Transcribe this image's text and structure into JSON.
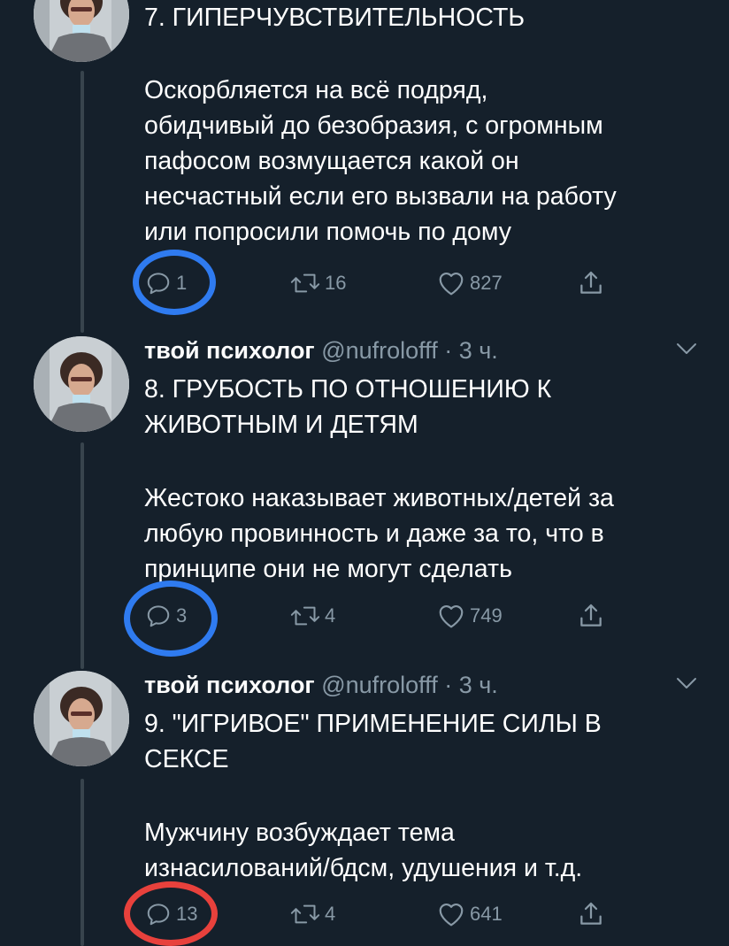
{
  "tweets": [
    {
      "author_name": "",
      "author_handle": "",
      "time": "",
      "heading": "7. ГИПЕРЧУВСТВИТЕЛЬНОСТЬ",
      "body": "Оскорбляется на всё подряд,\nобидчивый до безобразия, с огромным\nпафосом возмущается какой он\nнесчастный если его вызвали на работу\nили попросили помочь по дому",
      "replies": "1",
      "retweets": "16",
      "likes": "827"
    },
    {
      "author_name": "твой психолог",
      "author_handle": "@nufrolofff",
      "time": "· 3 ч.",
      "heading": "8. ГРУБОСТЬ ПО ОТНОШЕНИЮ К\nЖИВОТНЫМ И ДЕТЯМ",
      "body": "Жестоко наказывает животных/детей за\nлюбую провинность  и даже за то, что в\nпринципе они не могут сделать",
      "replies": "3",
      "retweets": "4",
      "likes": "749"
    },
    {
      "author_name": "твой психолог",
      "author_handle": "@nufrolofff",
      "time": "· 3 ч.",
      "heading": "9. \"ИГРИВОЕ\" ПРИМЕНЕНИЕ СИЛЫ В\nСЕКСЕ",
      "body": "Мужчину возбуждает тема\nизнасилований/бдсм, удушения и т.д.",
      "replies": "13",
      "retweets": "4",
      "likes": "641"
    }
  ],
  "icons": {
    "reply": "reply-icon",
    "retweet": "retweet-icon",
    "like": "heart-icon",
    "share": "share-icon",
    "chevron": "chevron-down-icon"
  },
  "colors": {
    "background": "#15202b",
    "muted": "#8899a6",
    "thread_line": "#38444d",
    "annotation_blue": "#2f7bf0",
    "annotation_red": "#e8413c"
  }
}
